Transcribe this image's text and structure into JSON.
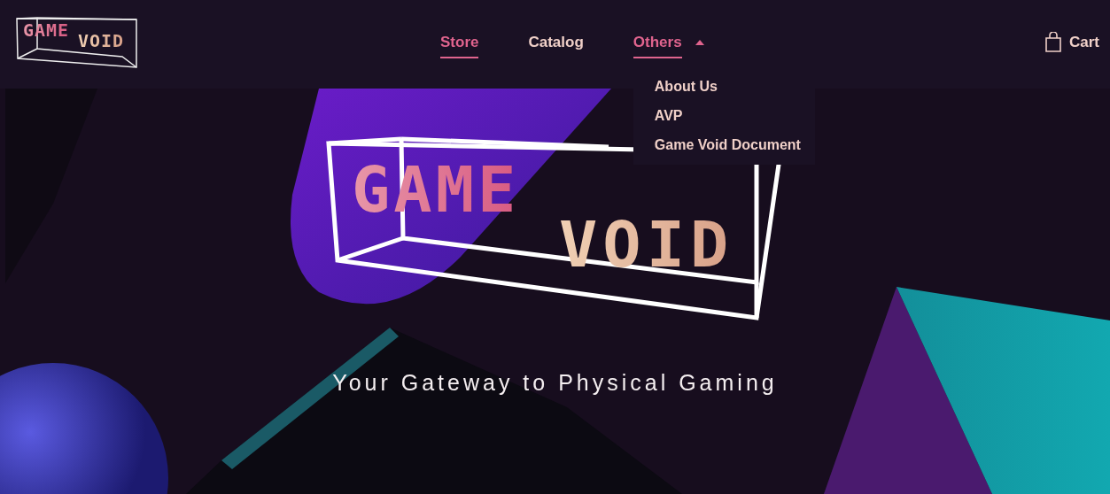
{
  "header": {
    "logo": {
      "line_1": "GAME",
      "line_2": "VOID"
    },
    "nav": [
      {
        "label": "Store",
        "kind": "link",
        "selected": true
      },
      {
        "label": "Catalog",
        "kind": "link",
        "selected": false
      },
      {
        "label": "Others",
        "kind": "menu",
        "selected": true,
        "expanded": true,
        "items": [
          "About Us",
          "AVP",
          "Game Void Document"
        ]
      }
    ],
    "cart": {
      "label": "Cart"
    }
  },
  "hero": {
    "logo": {
      "line_1": "GAME",
      "line_2": "VOID"
    },
    "tagline": "Your Gateway to Physical Gaming"
  }
}
